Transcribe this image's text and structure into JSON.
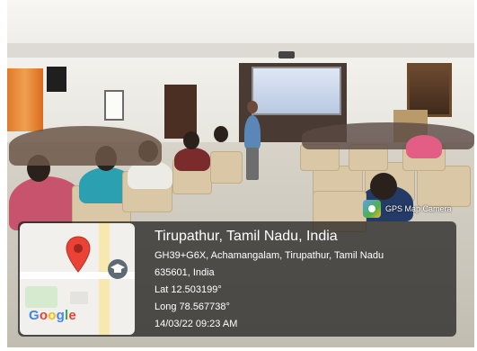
{
  "badge": {
    "label": "GPS Map Camera",
    "icon": "gps-map-camera-icon"
  },
  "location": {
    "title": "Tirupathur, Tamil Nadu, India",
    "address_line1": "GH39+G6X, Achamangalam, Tirupathur, Tamil Nadu",
    "address_line2": "635601, India",
    "lat": "Lat 12.503199°",
    "long": "Long 78.567738°",
    "datetime": "14/03/22 09:23 AM"
  },
  "map": {
    "logo": [
      "G",
      "o",
      "o",
      "g",
      "l",
      "e"
    ],
    "logo_colors": [
      "#4285F4",
      "#EA4335",
      "#FBBC05",
      "#4285F4",
      "#34A853",
      "#EA4335"
    ],
    "pin_color": "#EA4335"
  }
}
